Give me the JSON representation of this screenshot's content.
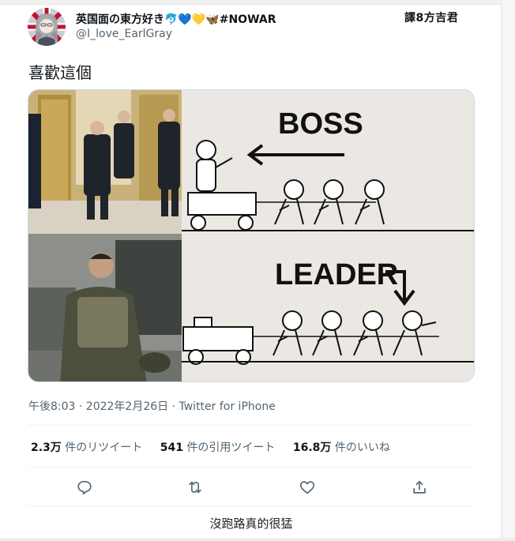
{
  "user": {
    "display_name": "英国面の東方好き🐬💙💛🦋#NOWAR",
    "handle": "@I_love_EarlGray"
  },
  "watermark": "譯8方吉君",
  "tweet": {
    "text": "喜歡這個",
    "meta": "午後8:03 · 2022年2月26日 · Twitter for iPhone"
  },
  "media": {
    "boss_label": "BOSS",
    "leader_label": "LEADER"
  },
  "stats": [
    {
      "count": "2.3万",
      "label": "件のリツイート"
    },
    {
      "count": "541",
      "label": "件の引用ツイート"
    },
    {
      "count": "16.8万",
      "label": "件のいいね"
    }
  ],
  "actions": [
    {
      "icon": "reply-icon"
    },
    {
      "icon": "retweet-icon"
    },
    {
      "icon": "like-icon"
    },
    {
      "icon": "share-icon"
    }
  ],
  "caption": "沒跑路真的很猛",
  "colors": {
    "text_primary": "#0f1419",
    "text_secondary": "#536471",
    "divider": "#eff3f4",
    "action_icon": "#536471"
  }
}
